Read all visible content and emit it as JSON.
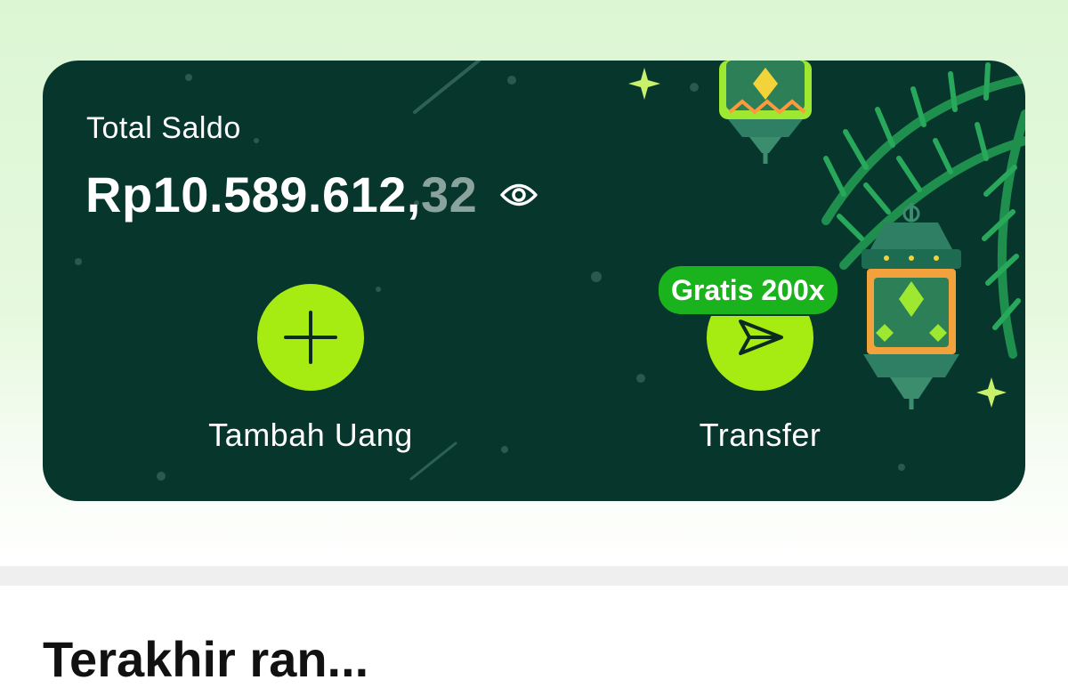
{
  "balance": {
    "label": "Total Saldo",
    "amount_main": "Rp10.589.612,",
    "amount_cents": "32"
  },
  "actions": [
    {
      "label": "Tambah Uang",
      "icon": "plus-icon"
    },
    {
      "label": "Transfer",
      "icon": "send-icon",
      "badge": "Gratis 200x"
    }
  ],
  "section": {
    "title": "Terakhir ran..."
  },
  "colors": {
    "card_bg": "#07362d",
    "action_green": "#a6ec12",
    "badge_green": "#1ab31d",
    "cents_grey": "#8aa39c",
    "page_top": "#dcf6d3"
  }
}
